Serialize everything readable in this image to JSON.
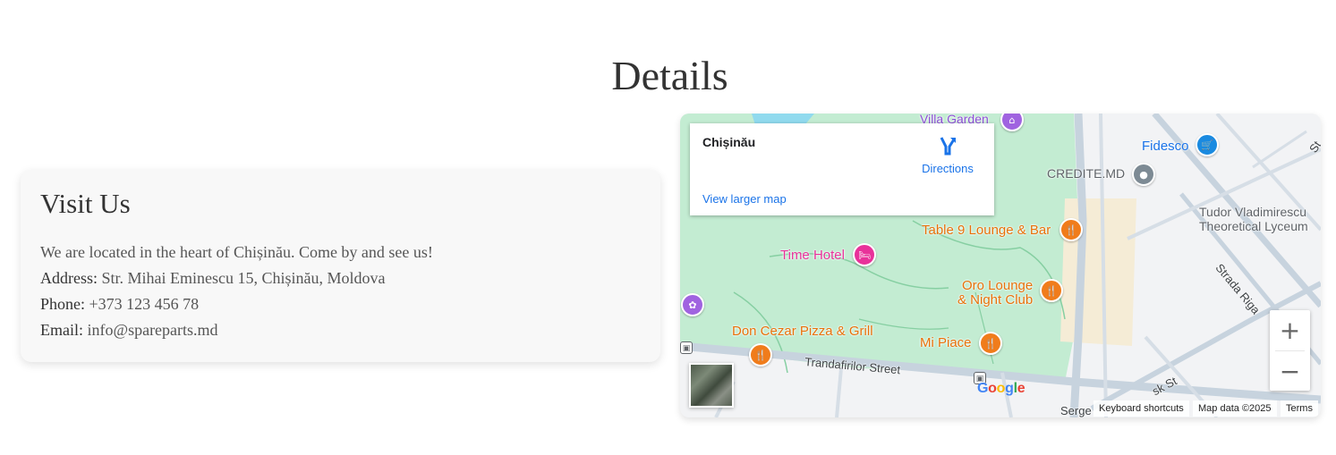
{
  "page": {
    "title": "Details"
  },
  "visit": {
    "heading": "Visit Us",
    "intro": "We are located in the heart of Chișinău. Come by and see us!",
    "address_label": "Address:",
    "address_value": " Str. Mihai Eminescu 15, Chișinău, Moldova",
    "phone_label": "Phone:",
    "phone_value": " +373 123 456 78",
    "email_label": "Email:",
    "email_value": " info@spareparts.md"
  },
  "map": {
    "infobox": {
      "place_name": "Chișinău",
      "directions_label": "Directions",
      "view_larger_label": "View larger map"
    },
    "pois": {
      "villa_garden": "Villa Garden",
      "fidesco": "Fidesco",
      "credite": "CREDITE.MD",
      "tudor_1": "Tudor Vladimirescu",
      "tudor_2": "Theoretical Lyceum",
      "table9": "Table 9 Lounge & Bar",
      "time_hotel": "Time Hotel",
      "oro_1": "Oro Lounge",
      "oro_2": "& Night Club",
      "don_cezar": "Don Cezar Pizza & Grill",
      "mi_piace": "Mi Piace"
    },
    "streets": {
      "trandafirilor": "Trandafirilor Street",
      "riga": "Strada Riga",
      "sk": "sk St",
      "serge": "Serge",
      "st": "St"
    },
    "google_logo": "Google",
    "attribution": {
      "shortcuts": "Keyboard shortcuts",
      "map_data": "Map data ©2025",
      "terms": "Terms"
    },
    "zoom_in": "+",
    "zoom_out": "−",
    "colors": {
      "park": "#c3ecd2",
      "road": "#c7d3de",
      "link": "#1a73e8",
      "orange_poi": "#e8710a",
      "pink_poi": "#e8329a"
    },
    "icons": [
      "directions-icon",
      "restaurant-icon",
      "hotel-icon",
      "shopping-cart-icon",
      "place-icon",
      "bus-stop-icon",
      "zoom-in-icon",
      "zoom-out-icon"
    ]
  }
}
